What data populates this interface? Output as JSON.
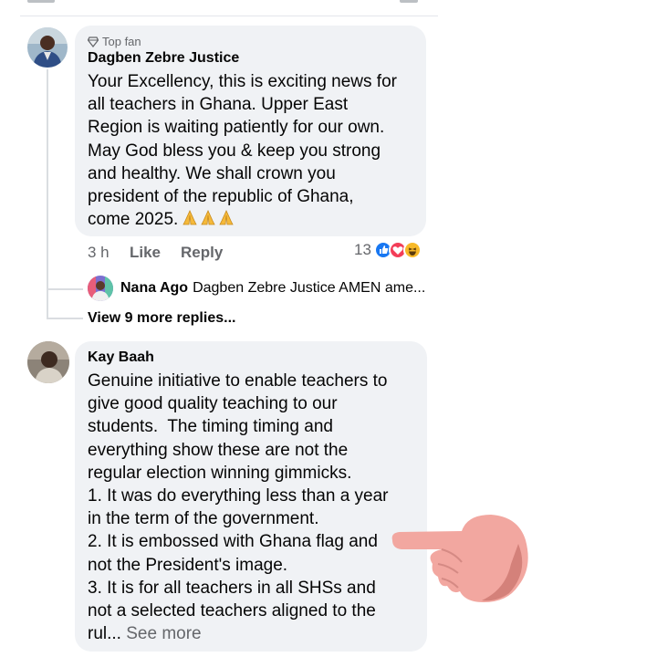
{
  "comment1": {
    "badge": "Top fan",
    "author": "Dagben Zebre Justice",
    "text": "Your Excellency, this is exciting news for\nall teachers in Ghana. Upper East\nRegion is waiting patiently for our own.\nMay God bless you & keep you strong\nand healthy. We shall crown you\npresident of the republic of Ghana,\ncome 2025.",
    "emoji": "🙏🙏🙏",
    "time": "3 h",
    "like_label": "Like",
    "reply_label": "Reply",
    "reaction_count": "13",
    "reaction_types": [
      "like-icon",
      "love-icon",
      "haha-icon"
    ],
    "reply": {
      "author": "Nana Ago",
      "text": "Dagben Zebre Justice AMEN ame..."
    },
    "view_more": "View 9 more replies..."
  },
  "comment2": {
    "author": "Kay Baah",
    "text": "Genuine initiative to enable teachers to\ngive good quality teaching to our\nstudents.  The timing timing and\neverything show these are not the\nregular election winning gimmicks.\n1. It was do everything less than a year\nin the term of the government.\n2. It is embossed with Ghana flag and\nnot the President's image.\n3. It is for all teachers in all SHSs and\nnot a selected teachers aligned to the\nrul...",
    "see_more": "See more"
  },
  "colors": {
    "bubble": "#f0f2f5",
    "secondary_text": "#65676b",
    "like_blue": "#1877f2",
    "love_red": "#f33e58",
    "haha_yellow": "#f7b928",
    "hand_pink": "#f2a7a0"
  }
}
